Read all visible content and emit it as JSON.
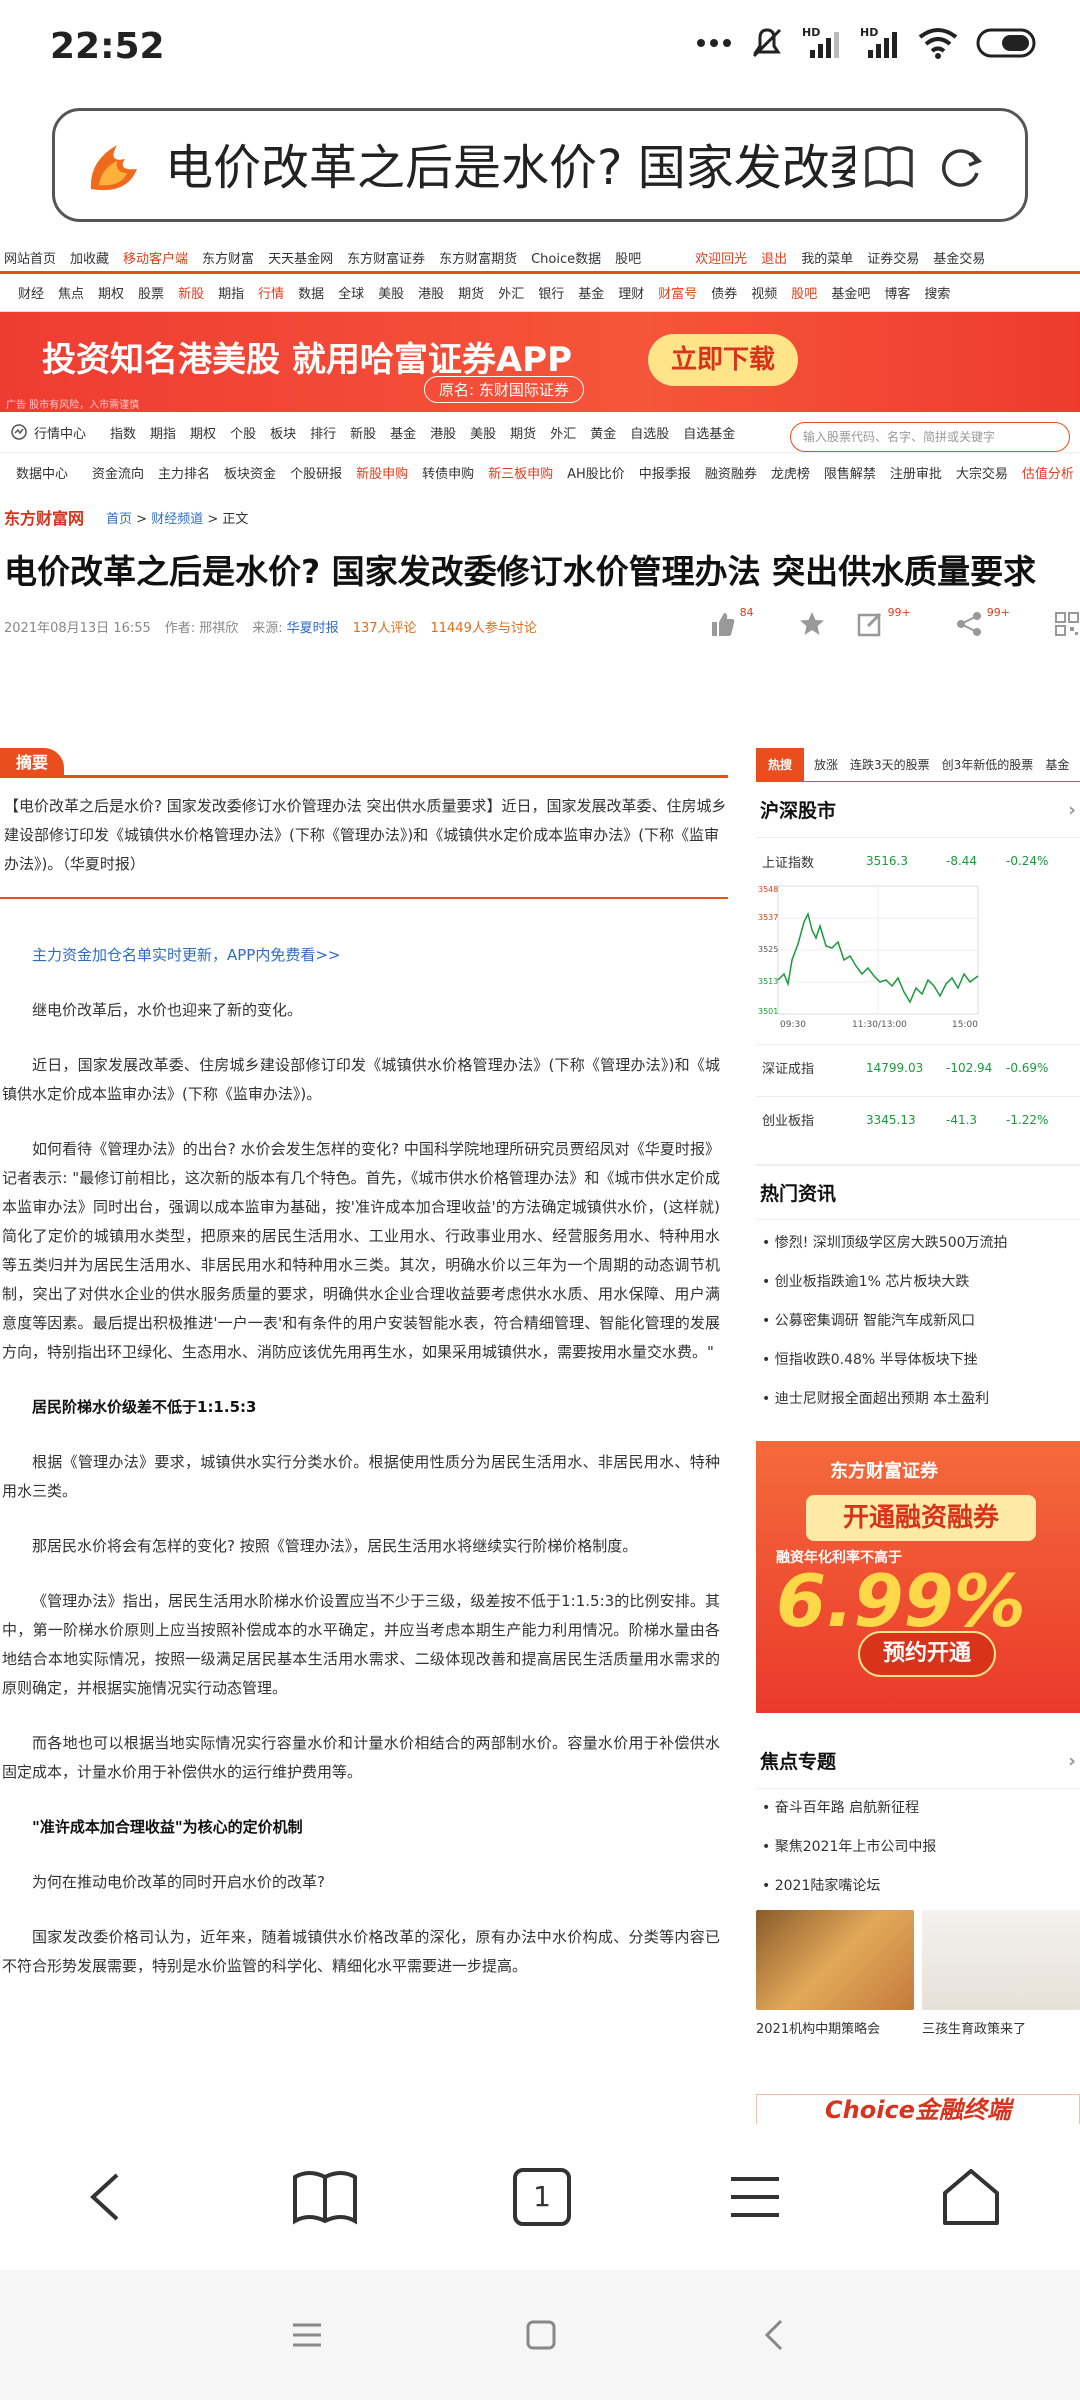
{
  "status": {
    "time": "22:52",
    "net1": "HD",
    "net2": "HD"
  },
  "browser": {
    "title": "电价改革之后是水价? 国家发改委"
  },
  "site_nav": {
    "items": [
      "网站首页",
      "加收藏",
      "移动客户端",
      "东方财富",
      "天天基金网",
      "东方财富证券",
      "东方财富期货",
      "Choice数据",
      "股吧"
    ],
    "right": [
      "欢迎回光",
      "退出",
      "我的菜单",
      "证券交易",
      "基金交易"
    ]
  },
  "channels": [
    "财经",
    "焦点",
    "期权",
    "股票",
    "新股",
    "期指",
    "行情",
    "数据",
    "全球",
    "美股",
    "港股",
    "期货",
    "外汇",
    "银行",
    "基金",
    "理财",
    "财富号",
    "债券",
    "视频",
    "股吧",
    "基金吧",
    "博客",
    "搜索"
  ],
  "banner": {
    "text": "投资知名港美股  就用哈富证券APP",
    "sub": "原名: 东财国际证券",
    "button": "立即下载",
    "ad": "广告  股市有风险，入市需谨慎"
  },
  "quotes": {
    "label": "行情中心",
    "items": [
      "指数",
      "期指",
      "期权",
      "个股",
      "板块",
      "排行",
      "新股",
      "基金",
      "港股",
      "美股",
      "期货",
      "外汇",
      "黄金",
      "自选股",
      "自选基金"
    ],
    "search_placeholder": "输入股票代码、名字、简拼或关键字"
  },
  "data_center": {
    "label": "数据中心",
    "items": [
      "资金流向",
      "主力排名",
      "板块资金",
      "个股研报",
      "新股申购",
      "转债申购",
      "新三板申购",
      "AH股比价",
      "中报季报",
      "融资融券",
      "龙虎榜",
      "限售解禁",
      "注册审批",
      "大宗交易",
      "估值分析"
    ]
  },
  "brand": {
    "logo": "东方财富网",
    "crumb_home": "首页",
    "crumb_channel": "财经频道",
    "crumb_current": "正文"
  },
  "article": {
    "title": "电价改革之后是水价? 国家发改委修订水价管理办法 突出供水质量要求",
    "date": "2021年08月13日 16:55",
    "author": "作者: 邢祺欣",
    "source_label": "来源:",
    "source": "华夏时报",
    "comments": "137人评论",
    "participants": "11449人参与讨论",
    "likes": "84",
    "badge1": "99+",
    "badge2": "99+",
    "summary_label": "摘要",
    "summary": "【电价改革之后是水价? 国家发改委修订水价管理办法 突出供水质量要求】近日，国家发展改革委、住房城乡建设部修订印发《城镇供水价格管理办法》(下称《管理办法》)和《城镇供水定价成本监审办法》(下称《监审办法》)。（华夏时报）",
    "link": "主力资金加仓名单实时更新，APP内免费看>>",
    "paragraphs": [
      "继电价改革后，水价也迎来了新的变化。",
      "近日，国家发展改革委、住房城乡建设部修订印发《城镇供水价格管理办法》(下称《管理办法》)和《城镇供水定价成本监审办法》(下称《监审办法》)。",
      "如何看待《管理办法》的出台? 水价会发生怎样的变化? 中国科学院地理所研究员贾绍凤对《华夏时报》记者表示: \"最修订前相比，这次新的版本有几个特色。首先，《城市供水价格管理办法》和《城市供水定价成本监审办法》同时出台，强调以成本监审为基础，按'准许成本加合理收益'的方法确定城镇供水价，(这样就)简化了定价的城镇用水类型，把原来的居民生活用水、工业用水、行政事业用水、经营服务用水、特种用水等五类归并为居民生活用水、非居民用水和特种用水三类。其次，明确水价以三年为一个周期的动态调节机制，突出了对供水企业的供水服务质量的要求，明确供水企业合理收益要考虑供水水质、用水保障、用户满意度等因素。最后提出积极推进'一户一表'和有条件的用户安装智能水表，符合精细管理、智能化管理的发展方向，特别指出环卫绿化、生态用水、消防应该优先用再生水，如果采用城镇供水，需要按用水量交水费。\"",
      "居民阶梯水价级差不低于1:1.5:3",
      "根据《管理办法》要求，城镇供水实行分类水价。根据使用性质分为居民生活用水、非居民用水、特种用水三类。",
      "那居民水价将会有怎样的变化? 按照《管理办法》，居民生活用水将继续实行阶梯价格制度。",
      "《管理办法》指出，居民生活用水阶梯水价设置应当不少于三级，级差按不低于1:1.5:3的比例安排。其中，第一阶梯水价原则上应当按照补偿成本的水平确定，并应当考虑本期生产能力利用情况。阶梯水量由各地结合本地实际情况，按照一级满足居民基本生活用水需求、二级体现改善和提高居民生活质量用水需求的原则确定，并根据实施情况实行动态管理。",
      "而各地也可以根据当地实际情况实行容量水价和计量水价相结合的两部制水价。容量水价用于补偿供水固定成本，计量水价用于补偿供水的运行维护费用等。",
      "\"准许成本加合理收益\"为核心的定价机制",
      "为何在推动电价改革的同时开启水价的改革?",
      "国家发改委价格司认为，近年来，随着城镇供水价格改革的深化，原有办法中水价构成、分类等内容已不符合形势发展需要，特别是水价监管的科学化、精细化水平需要进一步提高。"
    ]
  },
  "sidebar": {
    "hot_tag": "热搜",
    "hot_items": [
      "放涨",
      "连跌3天的股票",
      "创3年新低的股票",
      "基金"
    ],
    "market_title": "沪深股市",
    "indices": [
      {
        "name": "上证指数",
        "value": "3516.3",
        "change": "-8.44",
        "pct": "-0.24%"
      },
      {
        "name": "深证成指",
        "value": "14799.03",
        "change": "-102.94",
        "pct": "-0.69%"
      },
      {
        "name": "创业板指",
        "value": "3345.13",
        "change": "-41.3",
        "pct": "-1.22%"
      }
    ],
    "chart_labels": {
      "y": [
        "3548",
        "3537",
        "3525",
        "3513",
        "3501"
      ],
      "x": [
        "09:30",
        "11:30/13:00",
        "15:00"
      ]
    },
    "news_title": "热门资讯",
    "news": [
      "惨烈! 深圳顶级学区房大跌500万流拍",
      "创业板指跌逾1% 芯片板块大跌",
      "公募密集调研 智能汽车成新风口",
      "恒指收跌0.48% 半导体板块下挫",
      "迪士尼财报全面超出预期 本土盈利"
    ],
    "ad": {
      "brand": "东方财富证券",
      "slogan": "开通融资融券",
      "rate_label": "融资年化利率不高于",
      "rate": "6.99%",
      "button": "预约开通"
    },
    "focus_title": "焦点专题",
    "focus": [
      "奋斗百年路 启航新征程",
      "聚焦2021年上市公司中报",
      "2021陆家嘴论坛"
    ],
    "thumbs": [
      "2021机构中期策略会",
      "三孩生育政策来了"
    ],
    "choice": "Choice金融终端"
  },
  "toolbar": {
    "tabs_count": "1"
  }
}
